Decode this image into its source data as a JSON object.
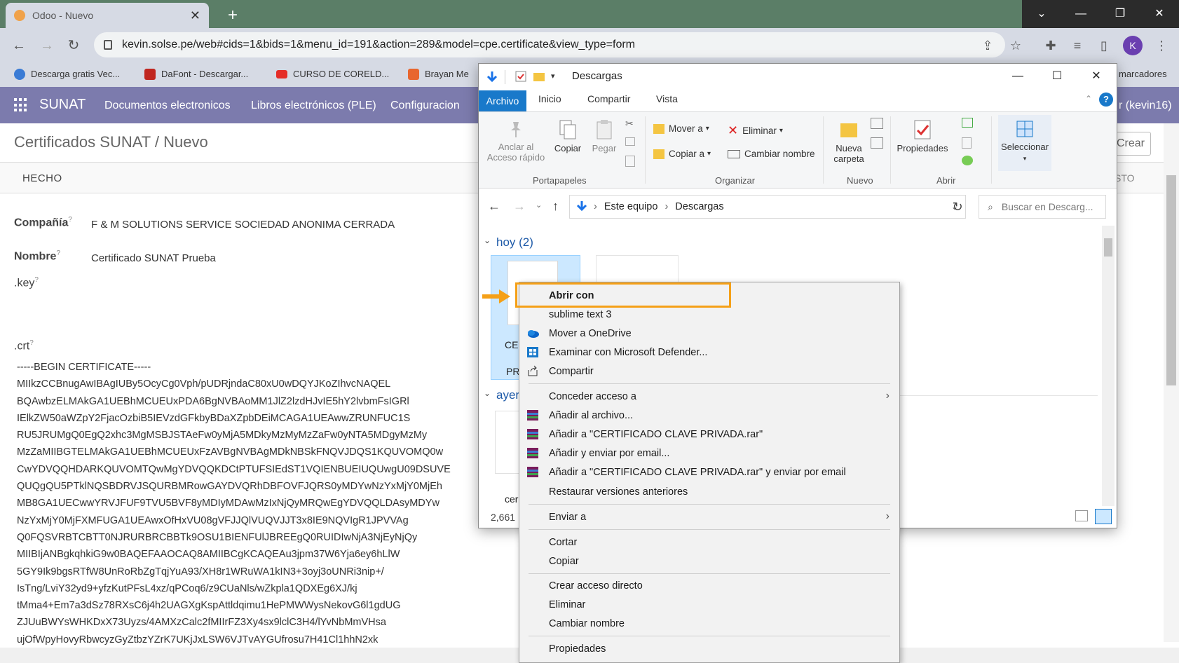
{
  "browser": {
    "tab_title": "Odoo - Nuevo",
    "url": "kevin.solse.pe/web#cids=1&bids=1&menu_id=191&action=289&model=cpe.certificate&view_type=form",
    "avatar_letter": "K",
    "bookmarks": [
      "Descarga gratis Vec...",
      "DaFont - Descargar...",
      "CURSO DE CORELD...",
      "Brayan Me",
      "marcadores"
    ]
  },
  "odoo": {
    "brand": "SUNAT",
    "menu": [
      "Documentos electronicos",
      "Libros electrónicos (PLE)",
      "Configuracion"
    ],
    "user": "r (kevin16)",
    "breadcrumb": "Certificados SUNAT / Nuevo",
    "create_label": "Crear",
    "status_left": "HECHO",
    "status_right": "STO",
    "fields": {
      "company_label": "Compañía",
      "company_value": "F & M SOLUTIONS SERVICE SOCIEDAD ANONIMA CERRADA",
      "name_label": "Nombre",
      "name_value": "Certificado SUNAT Prueba",
      "key_label": ".key",
      "crt_label": ".crt",
      "help_mark": "?"
    },
    "certificate_text": "-----BEGIN CERTIFICATE-----\nMIIkzCCBnugAwIBAgIUBy5OcyCg0Vph/pUDRjndaC80xU0wDQYJKoZIhvcNAQEL\nBQAwbzELMAkGA1UEBhMCUEUxPDA6BgNVBAoMM1JlZ2lzdHJvIE5hY2lvbmFsIGRl\nIElkZW50aWZpY2FjacOzbiB5IEVzdGFkbyBDaXZpbDEiMCAGA1UEAwwZRUNFUC1S\nRU5JRUMgQ0EgQ2xhc3MgMSBJSTAeFw0yMjA5MDkyMzMyMzZaFw0yNTA5MDgyMzMy\nMzZaMIIBGTELMAkGA1UEBhMCUEUxFzAVBgNVBAgMDkNBSkFNQVJDQS1KQUVOMQ0w\nCwYDVQQHDARKQUVOMTQwMgYDVQQKDCtPTUFSIEdST1VQIENBUEIUQUwgU09DSUVE\nQUQgQU5PTklNQSBDRVJSQURBMRowGAYDVQRhDBFOVFJQRS0yMDYwNzYxMjY0MjEh\nMB8GA1UECwwYRVJFUF9TVU5BVF8yMDIyMDAwMzIxNjQyMRQwEgYDVQQLDAsyMDYw\nNzYxMjY0MjFXMFUGA1UEAwxOfHxVU08gVFJJQlVUQVJJT3x8IE9NQVIgR1JPVVAg\nQ0FQSVRBTCBTT0NJRURBRCBBTk9OSU1BIENFUlJBREEgQ0RUIDIwNjA3NjEyNjQy\nMIIBIjANBgkqhkiG9w0BAQEFAAOCAQ8AMIIBCgKCAQEAu3jpm37W6Yja6ey6hLlW\n5GY9Ik9bgsRTfW8UnRoRbZgTqjYuA93/XH8r1WRuWA1kIN3+3oyj3oUNRi3nip+/\nIsTng/LviY32yd9+yfzKutPFsL4xz/qPCoq6/z9CUaNls/wZkpla1QDXEg6XJ/kj\ntMma4+Em7a3dSz78RXsC6j4h2UAGXgKspAttldqimu1HePMWWysNekovG6l1gdUG\nZJUuBWYsWHKDxX73Uyzs/4AMXzCalc2fMIIrFZ3Xy4sx9lclC3H4/lYvNbMmVHsa\nujOfWpyHovyRbwcyzGyZtbzYZrK7UKjJxLSW6VJTvAYGUfrosu7H41Cl1hhN2xk"
  },
  "explorer": {
    "title": "Descargas",
    "tabs": [
      "Archivo",
      "Inicio",
      "Compartir",
      "Vista"
    ],
    "ribbon": {
      "anclar": "Anclar al Acceso rápido",
      "copiar": "Copiar",
      "pegar": "Pegar",
      "portapapeles": "Portapapeles",
      "mover_a": "Mover a",
      "copiar_a": "Copiar a",
      "eliminar": "Eliminar",
      "cambiar_nombre": "Cambiar nombre",
      "organizar": "Organizar",
      "nueva_carpeta": "Nueva carpeta",
      "nuevo": "Nuevo",
      "propiedades": "Propiedades",
      "abrir": "Abrir",
      "seleccionar": "Seleccionar"
    },
    "path": [
      "Este equipo",
      "Descargas"
    ],
    "search_placeholder": "Buscar en Descarg...",
    "group_today": "hoy (2)",
    "group_yesterday": "ayer",
    "file_label_1": "CE",
    "file_label_2": "PR",
    "file_label_3": "cer",
    "status_count": "2,661"
  },
  "context_menu": {
    "items": [
      {
        "label": "Abrir con",
        "bold": true
      },
      {
        "label": "sublime text 3"
      },
      {
        "label": "Mover a OneDrive",
        "icon": "onedrive-icon"
      },
      {
        "label": "Examinar con Microsoft Defender...",
        "icon": "defender-icon"
      },
      {
        "label": "Compartir",
        "icon": "share-icon"
      },
      {
        "label": "Conceder acceso a",
        "submenu": true
      },
      {
        "label": "Añadir al archivo...",
        "icon": "winrar-icon"
      },
      {
        "label": "Añadir a \"CERTIFICADO CLAVE PRIVADA.rar\"",
        "icon": "winrar-icon"
      },
      {
        "label": "Añadir y enviar por email...",
        "icon": "winrar-icon"
      },
      {
        "label": "Añadir a \"CERTIFICADO CLAVE PRIVADA.rar\" y enviar por email",
        "icon": "winrar-icon"
      },
      {
        "label": "Restaurar versiones anteriores"
      },
      {
        "label": "Enviar a",
        "submenu": true
      },
      {
        "label": "Cortar"
      },
      {
        "label": "Copiar"
      },
      {
        "label": "Crear acceso directo"
      },
      {
        "label": "Eliminar"
      },
      {
        "label": "Cambiar nombre"
      },
      {
        "label": "Propiedades"
      }
    ]
  },
  "colors": {
    "odoo_nav": "#7c7bad",
    "highlight": "#f5a017",
    "explorer_accent": "#1979ca"
  }
}
